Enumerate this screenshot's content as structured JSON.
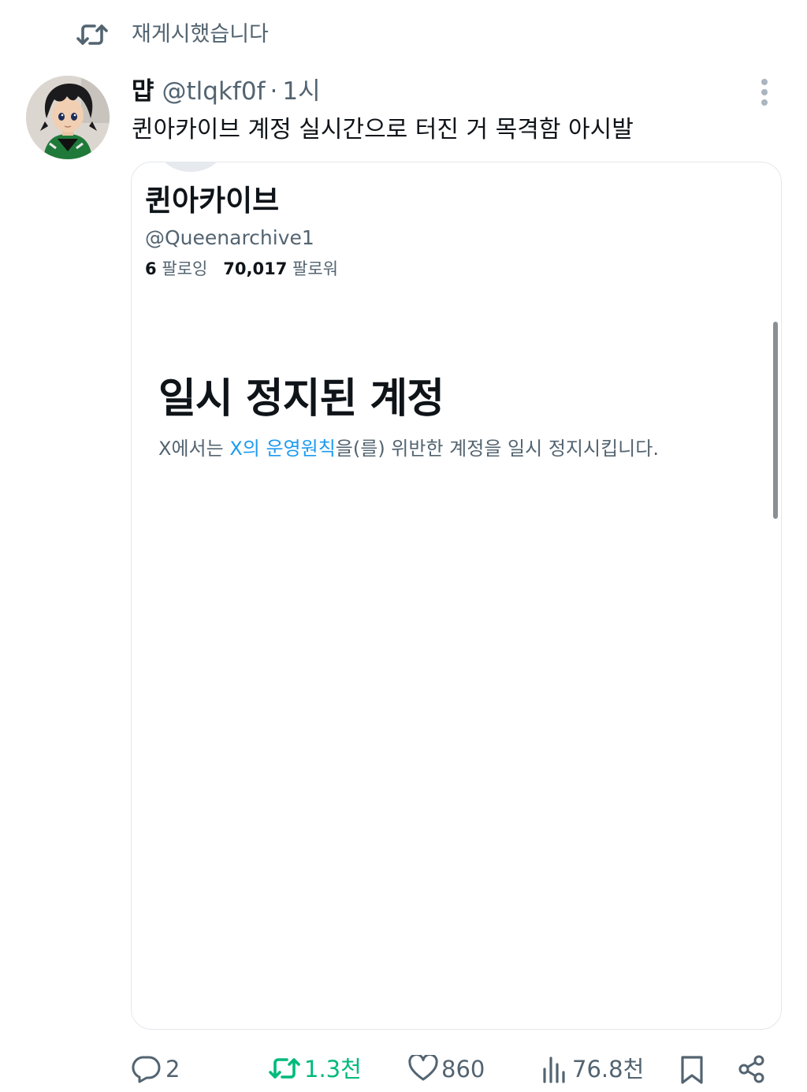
{
  "repost_banner": {
    "icon": "repost-icon",
    "text": "재게시했습니다"
  },
  "tweet": {
    "author": {
      "display_name": "먑",
      "handle": "@tlqkf0f",
      "avatar_icon": "avatar-figure"
    },
    "separator": "·",
    "time": "1시",
    "more_icon": "more-dots-icon",
    "text": "퀸아카이브 계정 실시간으로 터진 거 목격함 아시발"
  },
  "embedded_screenshot": {
    "profile_name": "퀸아카이브",
    "profile_handle": "@Queenarchive1",
    "following_count": "6",
    "following_label": "팔로잉",
    "followers_count": "70,017",
    "followers_label": "팔로워",
    "suspended_title": "일시 정지된 계정",
    "description_prefix": "X에서는 ",
    "description_link": "X의 운영원칙",
    "description_suffix": "을(를) 위반한 계정을 일시 정지시킵니다."
  },
  "actions": {
    "reply": {
      "icon": "reply-icon",
      "count": "2"
    },
    "repost": {
      "icon": "repost-icon",
      "count": "1.3천",
      "color": "#00ba7c"
    },
    "like": {
      "icon": "heart-icon",
      "count": "860"
    },
    "views": {
      "icon": "views-icon",
      "count": "76.8천"
    },
    "bookmark": {
      "icon": "bookmark-icon"
    },
    "share": {
      "icon": "share-icon"
    }
  },
  "colors": {
    "text_primary": "#0f1419",
    "text_secondary": "#536471",
    "link": "#1d9bf0",
    "repost_active": "#00ba7c"
  }
}
